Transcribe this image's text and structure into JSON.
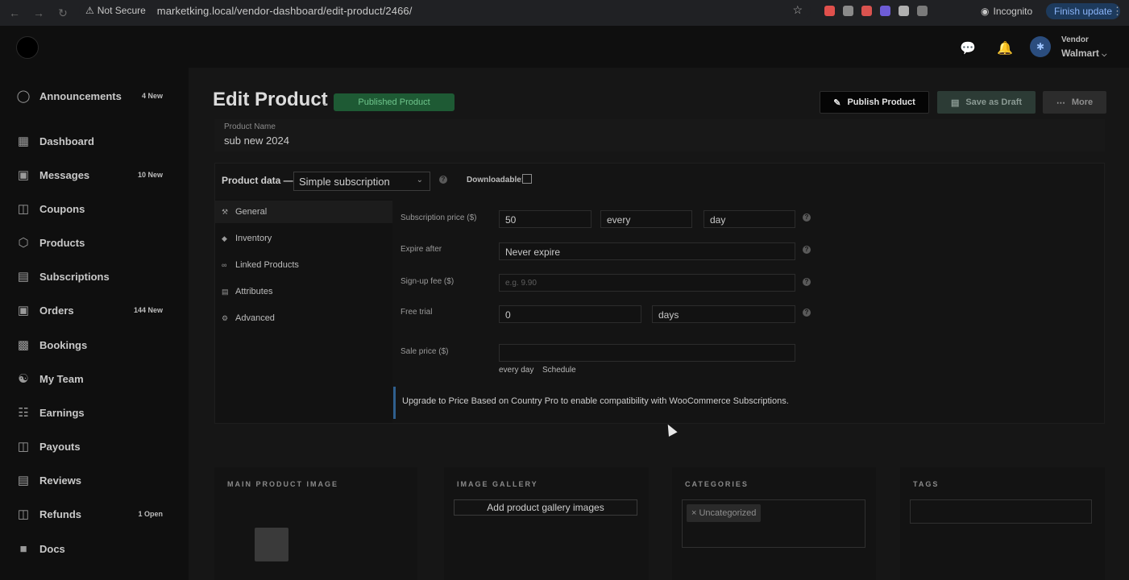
{
  "browser": {
    "not_secure": "Not Secure",
    "url": "marketking.local/vendor-dashboard/edit-product/2466/",
    "incognito": "Incognito",
    "finish_update": "Finish update",
    "extension_colors": [
      "#e0504c",
      "#8a8a8a",
      "#d9534f",
      "#6d5cd6",
      "#b0b0b0",
      "#7a7a7a"
    ]
  },
  "header": {
    "vendor_label": "Vendor",
    "vendor_name": "Walmart"
  },
  "sidebar": {
    "items": [
      {
        "label": "Announcements",
        "badge": "4 New",
        "icon": "bell-icon"
      },
      {
        "label": "Dashboard",
        "badge": "",
        "icon": "dashboard-icon"
      },
      {
        "label": "Messages",
        "badge": "10 New",
        "icon": "chat-icon"
      },
      {
        "label": "Coupons",
        "badge": "",
        "icon": "coupon-icon"
      },
      {
        "label": "Products",
        "badge": "",
        "icon": "box-icon"
      },
      {
        "label": "Subscriptions",
        "badge": "",
        "icon": "subscription-icon"
      },
      {
        "label": "Orders",
        "badge": "144 New",
        "icon": "orders-icon"
      },
      {
        "label": "Bookings",
        "badge": "",
        "icon": "calendar-icon"
      },
      {
        "label": "My Team",
        "badge": "",
        "icon": "team-icon"
      },
      {
        "label": "Earnings",
        "badge": "",
        "icon": "earnings-icon"
      },
      {
        "label": "Payouts",
        "badge": "",
        "icon": "payouts-icon"
      },
      {
        "label": "Reviews",
        "badge": "",
        "icon": "reviews-icon"
      },
      {
        "label": "Refunds",
        "badge": "1 Open",
        "icon": "refunds-icon"
      },
      {
        "label": "Docs",
        "badge": "",
        "icon": "docs-icon"
      }
    ]
  },
  "page": {
    "title": "Edit Product",
    "separator": "-",
    "status_badge": "Published Product",
    "publish_button": "Publish Product",
    "draft_button": "Save as Draft",
    "more_button": "More"
  },
  "product": {
    "name_label": "Product Name",
    "name_value": "sub new 2024",
    "data_label": "Product data —",
    "type_value": "Simple subscription",
    "downloadable_label": "Downloadable:"
  },
  "tabs": {
    "items": [
      {
        "label": "General",
        "icon": "wrench-icon"
      },
      {
        "label": "Inventory",
        "icon": "tag-icon"
      },
      {
        "label": "Linked Products",
        "icon": "link-icon"
      },
      {
        "label": "Attributes",
        "icon": "table-icon"
      },
      {
        "label": "Advanced",
        "icon": "gear-icon"
      }
    ]
  },
  "general": {
    "sub_price_label": "Subscription price ($)",
    "sub_price_value": "50",
    "interval_value": "every",
    "period_value": "day",
    "expire_label": "Expire after",
    "expire_value": "Never expire",
    "signup_label": "Sign-up fee ($)",
    "signup_placeholder": "e.g. 9.90",
    "trial_label": "Free trial",
    "trial_value": "0",
    "trial_period": "days",
    "sale_label": "Sale price ($)",
    "sale_value": "",
    "every_day": "every day",
    "schedule_link": "Schedule",
    "notice": "Upgrade to Price Based on Country Pro to enable compatibility with WooCommerce Subscriptions."
  },
  "cards": {
    "main_image": "MAIN PRODUCT IMAGE",
    "gallery": "IMAGE GALLERY",
    "gallery_button": "Add product gallery images",
    "categories": "CATEGORIES",
    "category_tag": "× Uncategorized",
    "tags": "TAGS"
  }
}
